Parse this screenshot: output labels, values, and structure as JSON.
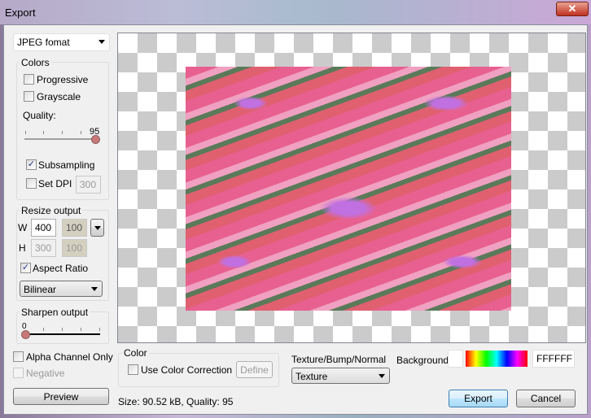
{
  "window": {
    "title": "Export",
    "close_icon": "close-x"
  },
  "format": {
    "selected": "JPEG fomat"
  },
  "colors": {
    "label": "Colors",
    "progressive": {
      "label": "Progressive",
      "checked": false
    },
    "grayscale": {
      "label": "Grayscale",
      "checked": false
    },
    "quality_label": "Quality:",
    "quality_value": "95",
    "quality_max": 100,
    "subsampling": {
      "label": "Subsampling",
      "checked": true
    },
    "set_dpi": {
      "label": "Set DPI",
      "checked": false,
      "value": "300"
    }
  },
  "resize": {
    "label": "Resize output",
    "w_label": "W",
    "w_value": "400",
    "w_percent": "100",
    "h_label": "H",
    "h_value": "300",
    "h_percent": "100",
    "aspect_ratio": {
      "label": "Aspect Ratio",
      "checked": true
    },
    "filter": "Bilinear"
  },
  "sharpen": {
    "label": "Sharpen output",
    "value": "0"
  },
  "alpha_only": {
    "label": "Alpha Channel Only",
    "checked": false
  },
  "negative": {
    "label": "Negative",
    "checked": false
  },
  "preview_button": "Preview",
  "color_group": {
    "label": "Color",
    "use_correction": {
      "label": "Use Color Correction",
      "checked": false
    },
    "define_button": "Define"
  },
  "texture": {
    "label": "Texture/Bump/Normal",
    "selected": "Texture"
  },
  "background": {
    "label": "Background",
    "hex": "FFFFFF",
    "color": "#ffffff"
  },
  "status": "Size: 90.52 kB,   Quality: 95",
  "export_button": "Export",
  "cancel_button": "Cancel"
}
